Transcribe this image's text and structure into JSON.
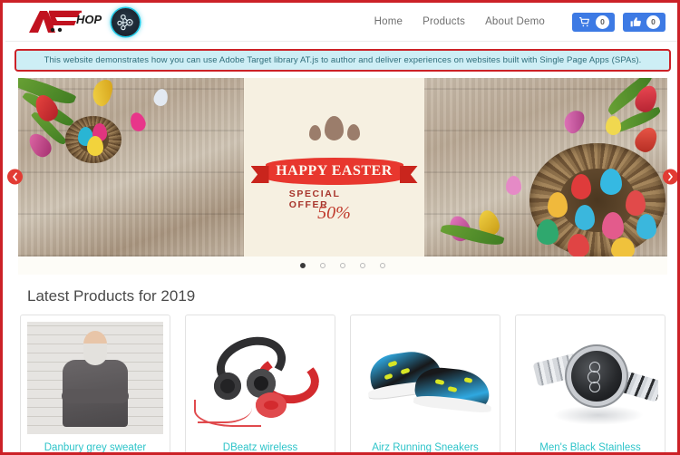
{
  "brand": {
    "logo_text": "HOP",
    "logo_letter": "A",
    "target_icon": "adobe-target-node-icon"
  },
  "header": {
    "nav_links": [
      {
        "label": "Home"
      },
      {
        "label": "Products"
      },
      {
        "label": "About Demo"
      }
    ],
    "cart": {
      "icon": "shopping-cart-icon",
      "count": "0"
    },
    "likes": {
      "icon": "thumbs-up-icon",
      "count": "0"
    }
  },
  "notice": {
    "text": "This website demonstrates how you can use Adobe Target library AT.js to author and deliver experiences on websites built with Single Page Apps (SPAs).",
    "border_color": "#cc2127",
    "background_color": "#cdeef5"
  },
  "carousel": {
    "prev_icon": "chevron-left-icon",
    "next_icon": "chevron-right-icon",
    "slide": {
      "headline": "HAPPY EASTER",
      "subhead": "SPECIAL OFFER",
      "discount": "50%"
    },
    "dots": [
      {
        "active": true
      },
      {
        "active": false
      },
      {
        "active": false
      },
      {
        "active": false
      },
      {
        "active": false
      }
    ]
  },
  "products": {
    "section_title": "Latest Products for 2019",
    "link_color": "#2ec4c9",
    "items": [
      {
        "title": "Danbury grey sweater",
        "image": "man-in-grey-sweater-photo"
      },
      {
        "title": "DBeatz wireless",
        "image": "red-black-headphones-photo"
      },
      {
        "title": "Airz Running Sneakers",
        "image": "blue-running-sneakers-photo"
      },
      {
        "title": "Men's Black Stainless",
        "image": "silver-black-wristwatch-photo"
      }
    ]
  }
}
